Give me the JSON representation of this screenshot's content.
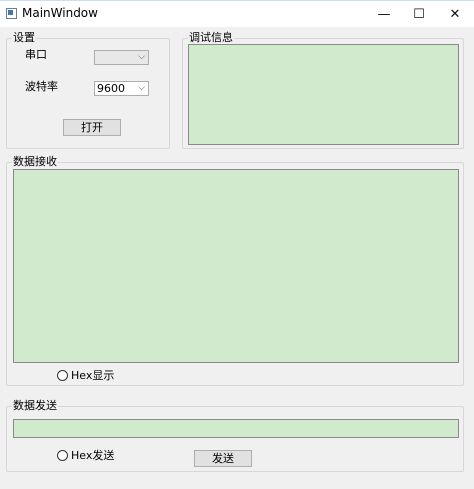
{
  "window": {
    "title": "MainWindow",
    "minimize_glyph": "—",
    "maximize_glyph": "☐",
    "close_glyph": "✕"
  },
  "settings": {
    "title": "设置",
    "port_label": "串口",
    "port_value": "",
    "baud_label": "波特率",
    "baud_value": "9600",
    "open_button": "打开"
  },
  "debug": {
    "title": "调试信息",
    "content": ""
  },
  "receive": {
    "title": "数据接收",
    "content": "",
    "hex_display_label": "Hex显示"
  },
  "send": {
    "title": "数据发送",
    "input_value": "",
    "hex_send_label": "Hex发送",
    "send_button": "发送"
  },
  "colors": {
    "text_area_bg": "#d1e9cc",
    "window_bg": "#f0f0f0"
  }
}
